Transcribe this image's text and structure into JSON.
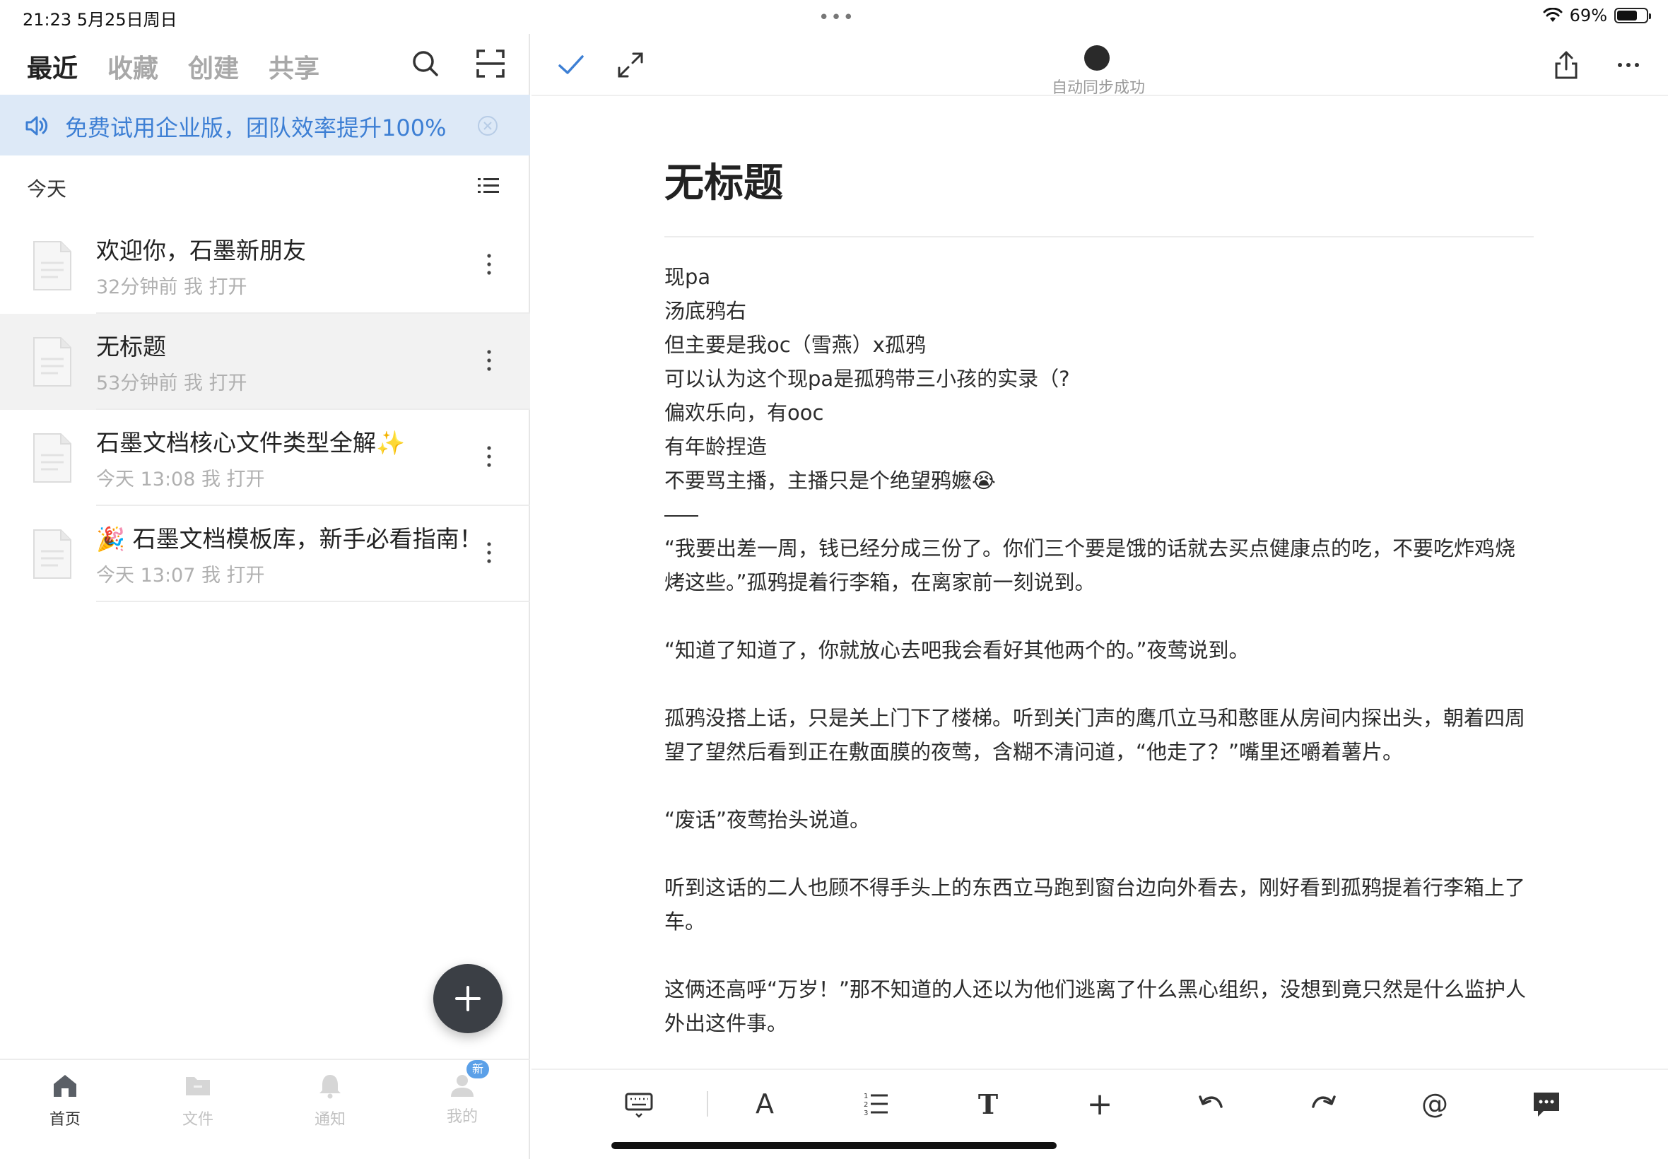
{
  "status_bar": {
    "time_date": "21:23   5月25日周日",
    "battery_text": "69%",
    "battery_level": 0.69
  },
  "left_nav": {
    "tabs": [
      "最近",
      "收藏",
      "创建",
      "共享"
    ],
    "active_tab": "最近"
  },
  "banner": {
    "text": "免费试用企业版，团队效率提升100%"
  },
  "section": {
    "label": "今天"
  },
  "documents": [
    {
      "title": "欢迎你，石墨新朋友",
      "meta": "32分钟前 我 打开"
    },
    {
      "title": "无标题",
      "meta": "53分钟前 我 打开"
    },
    {
      "title": "石墨文档核心文件类型全解✨",
      "meta": "今天 13:08 我 打开"
    },
    {
      "title": "🎉 石墨文档模板库，新手必看指南！",
      "meta": "今天 13:07 我 打开"
    }
  ],
  "bottom_nav": {
    "items": [
      "首页",
      "文件",
      "通知",
      "我的"
    ],
    "badge": "新"
  },
  "editor": {
    "sync_status": "自动同步成功",
    "doc_title": "无标题",
    "lines": [
      "现pa",
      "汤底鸦右",
      "但主要是我oc（雪燕）x孤鸦",
      "可以认为这个现pa是孤鸦带三小孩的实录（?",
      "偏欢乐向，有ooc",
      "有年龄捏造",
      "不要骂主播，主播只是个绝望鸦嬷😭"
    ],
    "paragraphs": [
      "“我要出差一周，钱已经分成三份了。你们三个要是饿的话就去买点健康点的吃，不要吃炸鸡烧烤这些。”孤鸦提着行李箱，在离家前一刻说到。",
      "“知道了知道了，你就放心去吧我会看好其他两个的。”夜莺说到。",
      "孤鸦没搭上话，只是关上门下了楼梯。听到关门声的鹰爪立马和憨匪从房间内探出头，朝着四周望了望然后看到正在敷面膜的夜莺，含糊不清问道，“他走了？”嘴里还嚼着薯片。",
      "“废话”夜莺抬头说道。",
      "听到这话的二人也顾不得手头上的东西立马跑到窗台边向外看去，刚好看到孤鸦提着行李箱上了车。",
      "这俩还高呼“万岁！”那不知道的人还以为他们逃离了什么黑心组织，没想到竟只然是什么监护人外出这件事。"
    ]
  },
  "editor_toolbar": {
    "font_label": "A",
    "text_label": "T",
    "mention_label": "@",
    "add_label": "+"
  },
  "colors": {
    "accent": "#3d7fd4",
    "banner_bg": "#dde9f7",
    "fab_bg": "#3b3f45"
  }
}
